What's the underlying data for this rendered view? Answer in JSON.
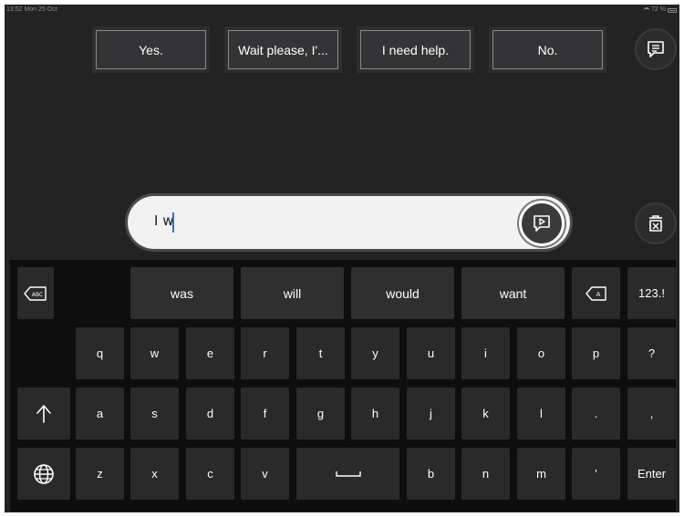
{
  "status_bar": {
    "time_date": "13:52  Mon 25 Oct",
    "battery": "72 %"
  },
  "quick_phrases": [
    "Yes.",
    "Wait please, I'...",
    "I need help.",
    "No."
  ],
  "input": {
    "text": "I w"
  },
  "suggestions": [
    "was",
    "will",
    "would",
    "want"
  ],
  "keys": {
    "numbers_mode": "123.!",
    "row1": [
      "q",
      "w",
      "e",
      "r",
      "t",
      "y",
      "u",
      "i",
      "o",
      "p",
      "?"
    ],
    "row2": [
      "a",
      "s",
      "d",
      "f",
      "g",
      "h",
      "j",
      "k",
      "l",
      ".",
      ","
    ],
    "row3_left": [
      "z",
      "x",
      "c",
      "v"
    ],
    "row3_right": [
      "b",
      "n",
      "m",
      "'"
    ],
    "enter": "Enter"
  },
  "icons": {
    "phrases": "chat-bubble-lines-icon",
    "clear": "trash-x-icon",
    "speak": "speech-bubble-play-icon",
    "delete_word": "backspace-abc-icon",
    "delete_char": "backspace-a-icon",
    "shift": "shift-arrow-icon",
    "globe": "globe-icon",
    "space": "space-bar-icon"
  },
  "colors": {
    "background": "#232324",
    "keyboard": "#0e0e0f",
    "key": "#2a2a2b",
    "caret": "#2f6de0"
  }
}
